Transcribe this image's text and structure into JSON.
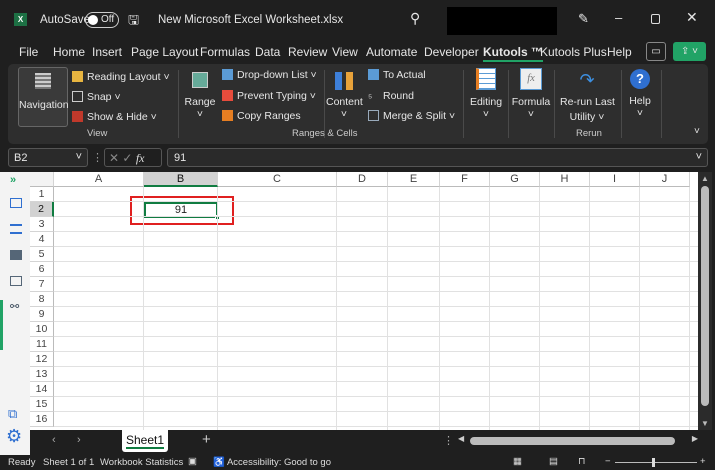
{
  "titlebar": {
    "app_icon": "excel-icon",
    "autosave_label": "AutoSave",
    "autosave_state": "Off",
    "filename": "New Microsoft Excel Worksheet.xlsx"
  },
  "menu": [
    "File",
    "Home",
    "Insert",
    "Page Layout",
    "Formulas",
    "Data",
    "Review",
    "View",
    "Automate",
    "Developer",
    "Kutools ™",
    "Kutools Plus",
    "Help"
  ],
  "menu_active": "Kutools ™",
  "ribbon": {
    "view": {
      "navigation": "Navigation",
      "reading_layout": "Reading Layout",
      "snap": "Snap",
      "show_hide": "Show & Hide",
      "group": "View"
    },
    "ranges": {
      "range": "Range",
      "dropdown_list": "Drop-down List",
      "prevent_typing": "Prevent Typing",
      "copy_ranges": "Copy Ranges",
      "content": "Content",
      "to_actual": "To Actual",
      "round": "Round",
      "merge_split": "Merge & Split",
      "group": "Ranges & Cells"
    },
    "editing": "Editing",
    "formula": "Formula",
    "rerun1": "Re-run Last",
    "rerun2": "Utility",
    "rerun_group": "Rerun",
    "help": "Help"
  },
  "formula_bar": {
    "name_box": "B2",
    "fx": "fx",
    "value": "91"
  },
  "grid": {
    "columns": [
      "A",
      "B",
      "C",
      "D",
      "E",
      "F",
      "G",
      "H",
      "I",
      "J"
    ],
    "rows": [
      "1",
      "2",
      "3",
      "4",
      "5",
      "6",
      "7",
      "8",
      "9",
      "10",
      "11",
      "12",
      "13",
      "14",
      "15",
      "16"
    ],
    "selected": "B2",
    "cell_b2": "91",
    "highlight_color": "#e02020"
  },
  "sheets": {
    "active": "Sheet1"
  },
  "status": {
    "ready": "Ready",
    "sheet": "Sheet 1 of 1",
    "stats": "Workbook Statistics",
    "accessibility": "Accessibility: Good to go"
  },
  "colors": {
    "accent_green": "#21a366",
    "bg": "#1f1f1f",
    "ribbon": "#2e2e2e"
  }
}
